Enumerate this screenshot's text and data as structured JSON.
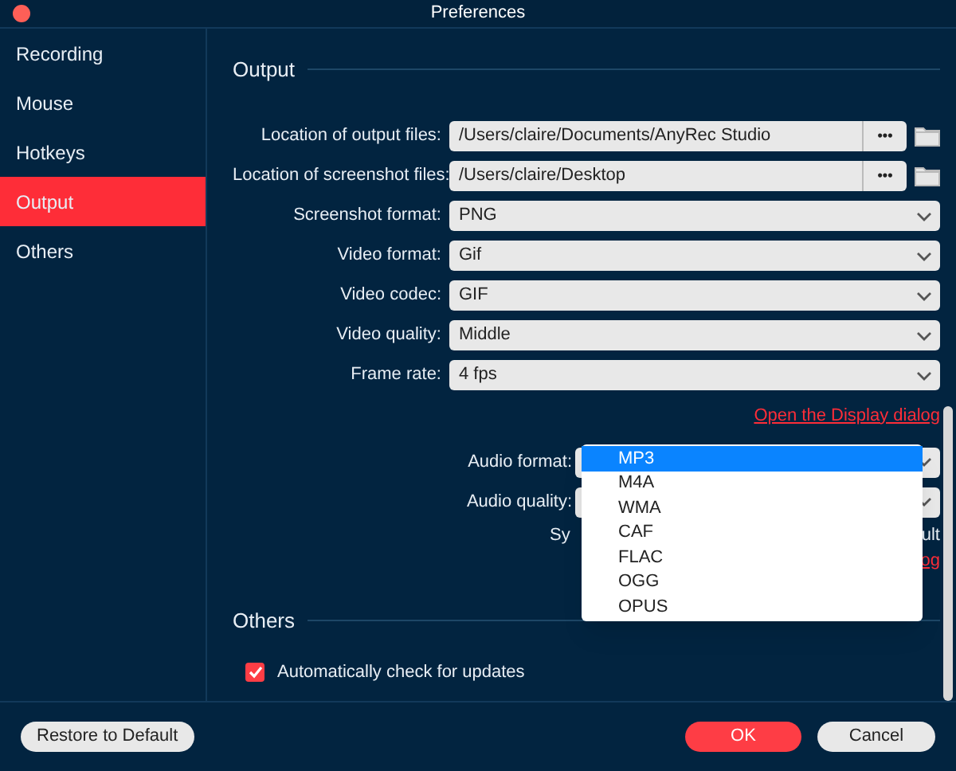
{
  "window": {
    "title": "Preferences"
  },
  "sidebar": {
    "items": [
      {
        "label": "Recording",
        "selected": false
      },
      {
        "label": "Mouse",
        "selected": false
      },
      {
        "label": "Hotkeys",
        "selected": false
      },
      {
        "label": "Output",
        "selected": true
      },
      {
        "label": "Others",
        "selected": false
      }
    ]
  },
  "output": {
    "heading": "Output",
    "rows": [
      {
        "kind": "path",
        "label": "Location of output files:",
        "value": "/Users/claire/Documents/AnyRec Studio",
        "browse": "•••"
      },
      {
        "kind": "path",
        "label": "Location of screenshot files:",
        "value": "/Users/claire/Desktop",
        "browse": "•••"
      },
      {
        "kind": "select",
        "label": "Screenshot format:",
        "value": "PNG"
      },
      {
        "kind": "select",
        "label": "Video format:",
        "value": "Gif"
      },
      {
        "kind": "select",
        "label": "Video codec:",
        "value": "GIF"
      },
      {
        "kind": "select",
        "label": "Video quality:",
        "value": "Middle"
      },
      {
        "kind": "select",
        "label": "Frame rate:",
        "value": "4 fps"
      }
    ],
    "display_link": "Open the Display dialog",
    "audio_rows": [
      {
        "label": "Audio format:"
      },
      {
        "label": "Audio quality:"
      }
    ],
    "hidden_row": {
      "left": "Sy",
      "right": "ult"
    },
    "hidden_link": "og",
    "dropdown": {
      "options": [
        {
          "label": "MP3",
          "selected": true
        },
        {
          "label": "M4A",
          "selected": false
        },
        {
          "label": "WMA",
          "selected": false
        },
        {
          "label": "CAF",
          "selected": false
        },
        {
          "label": "FLAC",
          "selected": false
        },
        {
          "label": "OGG",
          "selected": false
        },
        {
          "label": "OPUS",
          "selected": false
        }
      ]
    }
  },
  "others": {
    "heading": "Others",
    "checkbox": {
      "label": "Automatically check for updates",
      "checked": true
    }
  },
  "footer": {
    "restore": "Restore to Default",
    "ok": "OK",
    "cancel": "Cancel"
  }
}
